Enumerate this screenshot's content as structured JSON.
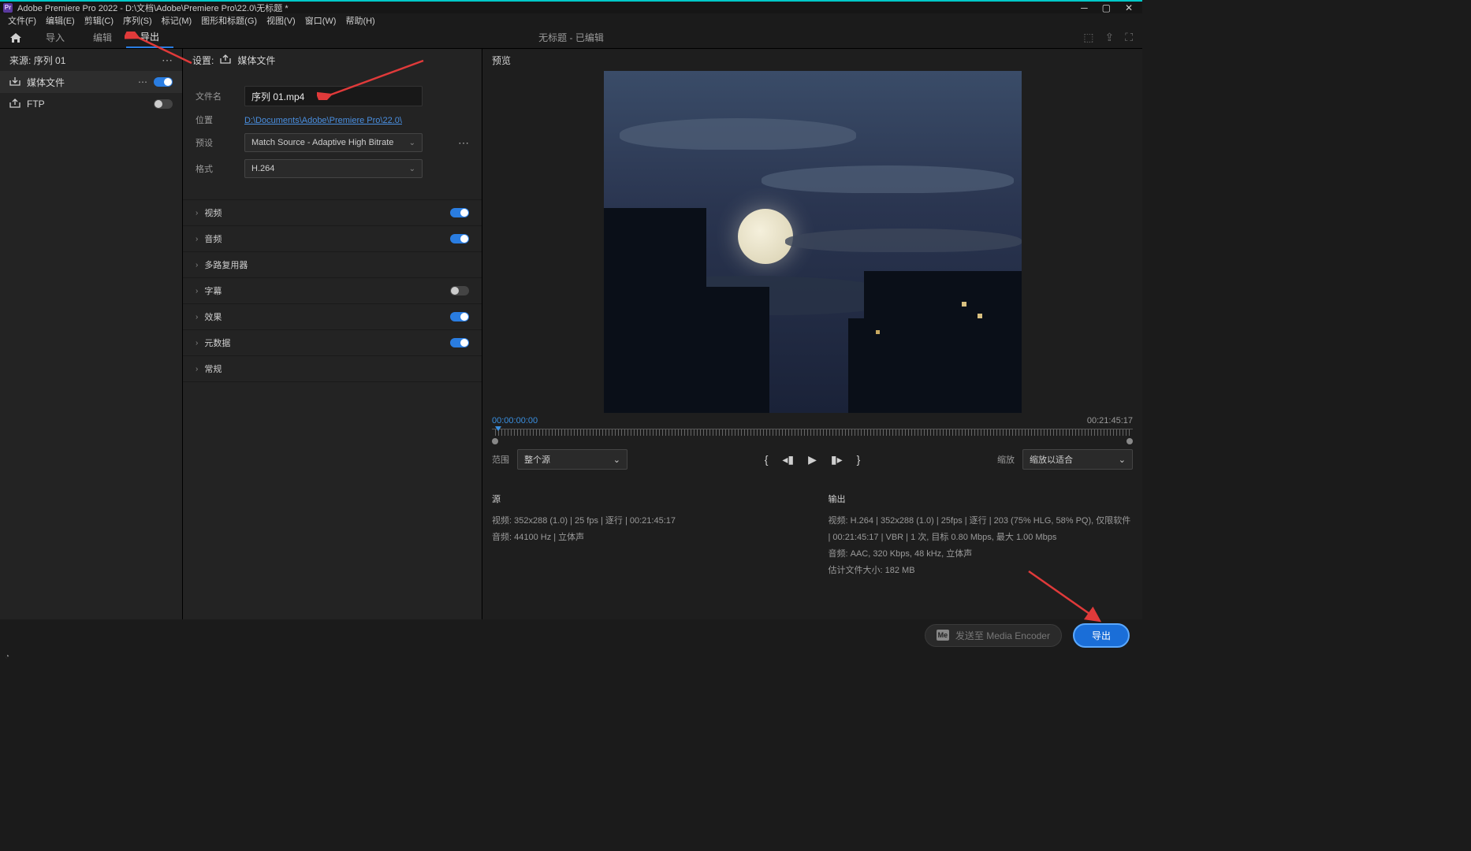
{
  "titlebar": {
    "app_icon_text": "Pr",
    "title": "Adobe Premiere Pro 2022 - D:\\文档\\Adobe\\Premiere Pro\\22.0\\无标题 *"
  },
  "menubar": {
    "items": [
      "文件(F)",
      "编辑(E)",
      "剪辑(C)",
      "序列(S)",
      "标记(M)",
      "图形和标题(G)",
      "视图(V)",
      "窗口(W)",
      "帮助(H)"
    ]
  },
  "toptabs": {
    "tabs": [
      {
        "label": "导入",
        "active": false
      },
      {
        "label": "编辑",
        "active": false
      },
      {
        "label": "导出",
        "active": true
      }
    ],
    "center": "无标题 - 已编辑"
  },
  "source_panel": {
    "label": "来源:",
    "value": "序列 01",
    "destinations": [
      {
        "icon": "download-icon",
        "label": "媒体文件",
        "more": true,
        "toggle": true
      },
      {
        "icon": "upload-icon",
        "label": "FTP",
        "more": false,
        "toggle": false
      }
    ]
  },
  "settings": {
    "header": "设置:",
    "header_sub": "媒体文件",
    "rows": {
      "filename_label": "文件名",
      "filename_value": "序列 01.mp4",
      "location_label": "位置",
      "location_value": "D:\\Documents\\Adobe\\Premiere Pro\\22.0\\",
      "preset_label": "预设",
      "preset_value": "Match Source - Adaptive High Bitrate",
      "format_label": "格式",
      "format_value": "H.264"
    },
    "sections": [
      {
        "label": "视频",
        "toggle": true,
        "has_toggle": true
      },
      {
        "label": "音频",
        "toggle": true,
        "has_toggle": true
      },
      {
        "label": "多路复用器",
        "toggle": null,
        "has_toggle": false
      },
      {
        "label": "字幕",
        "toggle": false,
        "has_toggle": true
      },
      {
        "label": "效果",
        "toggle": true,
        "has_toggle": true
      },
      {
        "label": "元数据",
        "toggle": true,
        "has_toggle": true
      },
      {
        "label": "常规",
        "toggle": null,
        "has_toggle": false
      }
    ]
  },
  "preview": {
    "header": "预览",
    "time_in": "00:00:00:00",
    "time_out": "00:21:45:17",
    "range_label": "范围",
    "range_value": "整个源",
    "scale_label": "缩放",
    "scale_value": "缩放以适合",
    "source": {
      "title": "源",
      "video_label": "视频:",
      "video_value": "352x288 (1.0) | 25 fps | 逐行 | 00:21:45:17",
      "audio_label": "音频:",
      "audio_value": "44100 Hz | 立体声"
    },
    "output": {
      "title": "输出",
      "video_label": "视频:",
      "video_value": "H.264 | 352x288 (1.0) | 25fps | 逐行 | 203 (75% HLG, 58% PQ), 仅限软件 | 00:21:45:17 | VBR | 1 次, 目标 0.80 Mbps, 最大 1.00 Mbps",
      "audio_label": "音频:",
      "audio_value": "AAC, 320 Kbps, 48 kHz, 立体声",
      "size_label": "估计文件大小:",
      "size_value": "182 MB"
    }
  },
  "bottom": {
    "me_icon": "Me",
    "me_label": "发送至 Media Encoder",
    "export_label": "导出"
  }
}
